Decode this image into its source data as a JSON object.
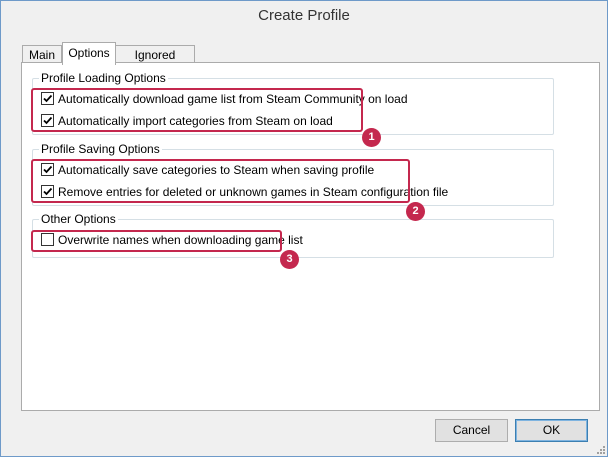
{
  "window": {
    "title": "Create Profile"
  },
  "tabs": [
    {
      "label": "Main",
      "active": false
    },
    {
      "label": "Options",
      "active": true
    },
    {
      "label": "Ignored Games",
      "active": false
    }
  ],
  "groups": {
    "profile_loading": {
      "label": "Profile Loading Options",
      "options": [
        {
          "label": "Automatically download game list from Steam Community on load",
          "checked": true
        },
        {
          "label": "Automatically import categories from Steam on load",
          "checked": true
        }
      ]
    },
    "profile_saving": {
      "label": "Profile Saving Options",
      "options": [
        {
          "label": "Automatically save categories to Steam when saving profile",
          "checked": true
        },
        {
          "label": "Remove entries for deleted or unknown games in Steam configuration file",
          "checked": true
        }
      ]
    },
    "other": {
      "label": "Other Options",
      "options": [
        {
          "label": "Overwrite names when downloading game list",
          "checked": false
        }
      ]
    }
  },
  "markers": [
    "1",
    "2",
    "3"
  ],
  "buttons": {
    "cancel": "Cancel",
    "ok": "OK"
  },
  "colors": {
    "highlight": "#c4284e",
    "window_border": "#6e9ac9"
  }
}
